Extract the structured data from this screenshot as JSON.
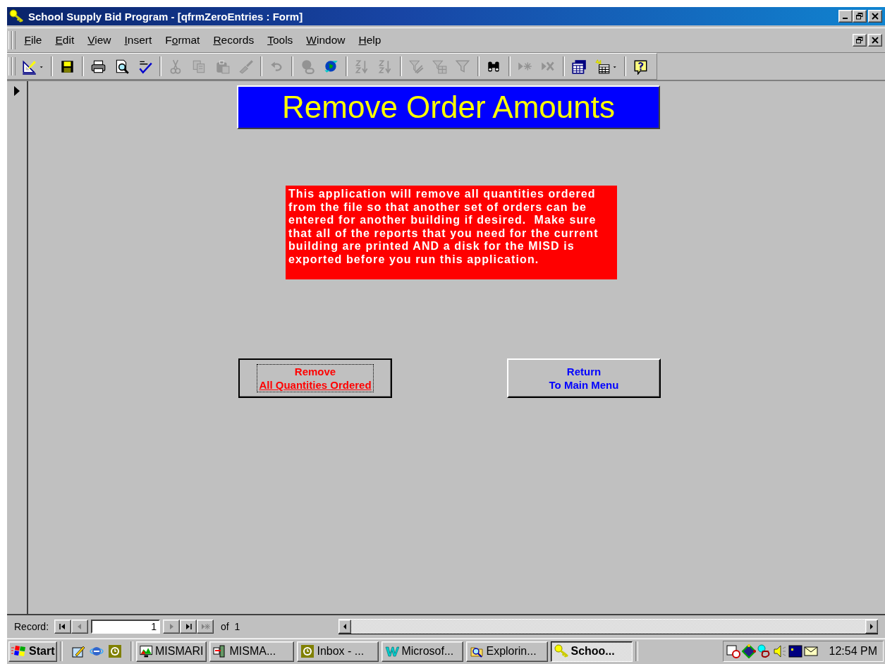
{
  "window": {
    "title": "School Supply Bid Program - [qfrmZeroEntries : Form]"
  },
  "menu": [
    {
      "key": "F",
      "post": "ile"
    },
    {
      "key": "E",
      "post": "dit"
    },
    {
      "key": "V",
      "post": "iew"
    },
    {
      "key": "I",
      "post": "nsert"
    },
    {
      "pre": "F",
      "key": "o",
      "post": "rmat"
    },
    {
      "key": "R",
      "post": "ecords"
    },
    {
      "key": "T",
      "post": "ools"
    },
    {
      "key": "W",
      "post": "indow"
    },
    {
      "key": "H",
      "post": "elp"
    }
  ],
  "toolbar": [
    {
      "kind": "design",
      "disabled": false
    },
    {
      "kind": "dropdown",
      "disabled": false
    },
    {
      "kind": "sep"
    },
    {
      "kind": "save",
      "disabled": false
    },
    {
      "kind": "sep"
    },
    {
      "kind": "print",
      "disabled": false
    },
    {
      "kind": "preview",
      "disabled": false
    },
    {
      "kind": "spelling",
      "disabled": false
    },
    {
      "kind": "sep"
    },
    {
      "kind": "cut",
      "disabled": true
    },
    {
      "kind": "copy",
      "disabled": true
    },
    {
      "kind": "paste",
      "disabled": true
    },
    {
      "kind": "brush",
      "disabled": true
    },
    {
      "kind": "sep"
    },
    {
      "kind": "undo",
      "disabled": true
    },
    {
      "kind": "sep"
    },
    {
      "kind": "hyperlink",
      "disabled": true
    },
    {
      "kind": "web",
      "disabled": false
    },
    {
      "kind": "sep"
    },
    {
      "kind": "sort-asc",
      "disabled": true
    },
    {
      "kind": "sort-desc",
      "disabled": true
    },
    {
      "kind": "sep"
    },
    {
      "kind": "filter-selection",
      "disabled": true
    },
    {
      "kind": "filter-form",
      "disabled": true
    },
    {
      "kind": "filter",
      "disabled": true
    },
    {
      "kind": "sep"
    },
    {
      "kind": "find",
      "disabled": false
    },
    {
      "kind": "sep"
    },
    {
      "kind": "new-record",
      "disabled": true
    },
    {
      "kind": "delete-record",
      "disabled": true
    },
    {
      "kind": "sep"
    },
    {
      "kind": "database",
      "disabled": false
    },
    {
      "kind": "new-object",
      "disabled": false
    },
    {
      "kind": "dropdown",
      "disabled": false
    },
    {
      "kind": "sep"
    },
    {
      "kind": "help",
      "disabled": false
    }
  ],
  "form": {
    "heading": "Remove Order Amounts",
    "notice": "This application will remove all quantities ordered from the file so that another set of orders can be entered for another building if desired.  Make sure that all of the reports that you need for the current building are printed AND a disk for the MISD is exported before you run this application.",
    "buttons": [
      {
        "lines": [
          "Remove",
          "All Quantities Ordered"
        ],
        "color": "#ff0000",
        "focused": true
      },
      {
        "lines": [
          "Return",
          "To Main Menu"
        ],
        "color": "#0000ff",
        "focused": false
      }
    ]
  },
  "record_nav": {
    "label": "Record:",
    "buttons": [
      {
        "kind": "first",
        "disabled": false
      },
      {
        "kind": "prev",
        "disabled": true
      }
    ],
    "value": "1",
    "after": [
      {
        "kind": "next",
        "disabled": true
      },
      {
        "kind": "last",
        "disabled": false
      },
      {
        "kind": "new",
        "disabled": true
      }
    ],
    "total": "of  1"
  },
  "taskbar": {
    "start": "Start",
    "quick_launch": [
      {
        "kind": "desktop"
      },
      {
        "kind": "browser"
      },
      {
        "kind": "mail"
      }
    ],
    "tasks": [
      {
        "label": "MISMARI",
        "kind": "picture",
        "selected": false
      },
      {
        "label": "MISMA...",
        "kind": "viewer",
        "selected": false
      },
      {
        "label": "Inbox - ...",
        "kind": "mail",
        "selected": false
      },
      {
        "label": "Microsof...",
        "kind": "word",
        "selected": false
      },
      {
        "label": "Explorin...",
        "kind": "explorer",
        "selected": false
      },
      {
        "label": "Schoo...",
        "kind": "key",
        "selected": true
      }
    ],
    "tray": [
      {
        "kind": "scheduler"
      },
      {
        "kind": "network"
      },
      {
        "kind": "search"
      },
      {
        "kind": "volume"
      },
      {
        "kind": "display"
      },
      {
        "kind": "mail"
      }
    ],
    "clock": "12:54 PM"
  }
}
